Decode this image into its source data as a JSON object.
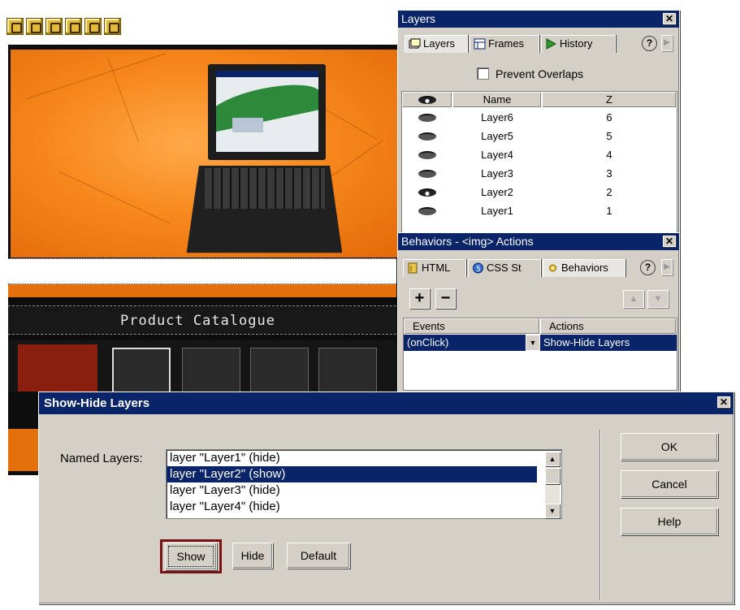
{
  "canvas": {
    "marker_count": 6,
    "catalogue_title": "Product Catalogue"
  },
  "layers_panel": {
    "title": "Layers",
    "tabs": [
      {
        "label": "Layers",
        "icon": "layers-icon"
      },
      {
        "label": "Frames",
        "icon": "frames-icon"
      },
      {
        "label": "History",
        "icon": "history-icon"
      }
    ],
    "help": "?",
    "prevent_overlaps": "Prevent Overlaps",
    "columns": {
      "name": "Name",
      "z": "Z"
    },
    "rows": [
      {
        "name": "Layer6",
        "z": "6",
        "visibility": "hidden"
      },
      {
        "name": "Layer5",
        "z": "5",
        "visibility": "hidden"
      },
      {
        "name": "Layer4",
        "z": "4",
        "visibility": "hidden"
      },
      {
        "name": "Layer3",
        "z": "3",
        "visibility": "hidden"
      },
      {
        "name": "Layer2",
        "z": "2",
        "visibility": "visible"
      },
      {
        "name": "Layer1",
        "z": "1",
        "visibility": "hidden"
      }
    ]
  },
  "behaviors_panel": {
    "title": "Behaviors - <img> Actions",
    "tabs": [
      {
        "label": "HTML",
        "icon": "html-icon"
      },
      {
        "label": "CSS St",
        "icon": "css-icon"
      },
      {
        "label": "Behaviors",
        "icon": "behaviors-icon"
      }
    ],
    "help": "?",
    "add": "+",
    "remove": "−",
    "columns": {
      "events": "Events",
      "actions": "Actions"
    },
    "row": {
      "event": "(onClick)",
      "action": "Show-Hide Layers"
    }
  },
  "dialog": {
    "title": "Show-Hide Layers",
    "named_layers_label": "Named Layers:",
    "items": [
      "layer \"Layer1\" (hide)",
      "layer \"Layer2\" (show)",
      "layer \"Layer3\" (hide)",
      "layer \"Layer4\" (hide)"
    ],
    "selected_index": 1,
    "buttons": {
      "show": "Show",
      "hide": "Hide",
      "default": "Default",
      "ok": "OK",
      "cancel": "Cancel",
      "help": "Help"
    }
  },
  "colors": {
    "titlebar": "#0a246a",
    "face": "#d4d0c8",
    "orange": "#f7881c",
    "highlight_frame": "#7a1212"
  }
}
